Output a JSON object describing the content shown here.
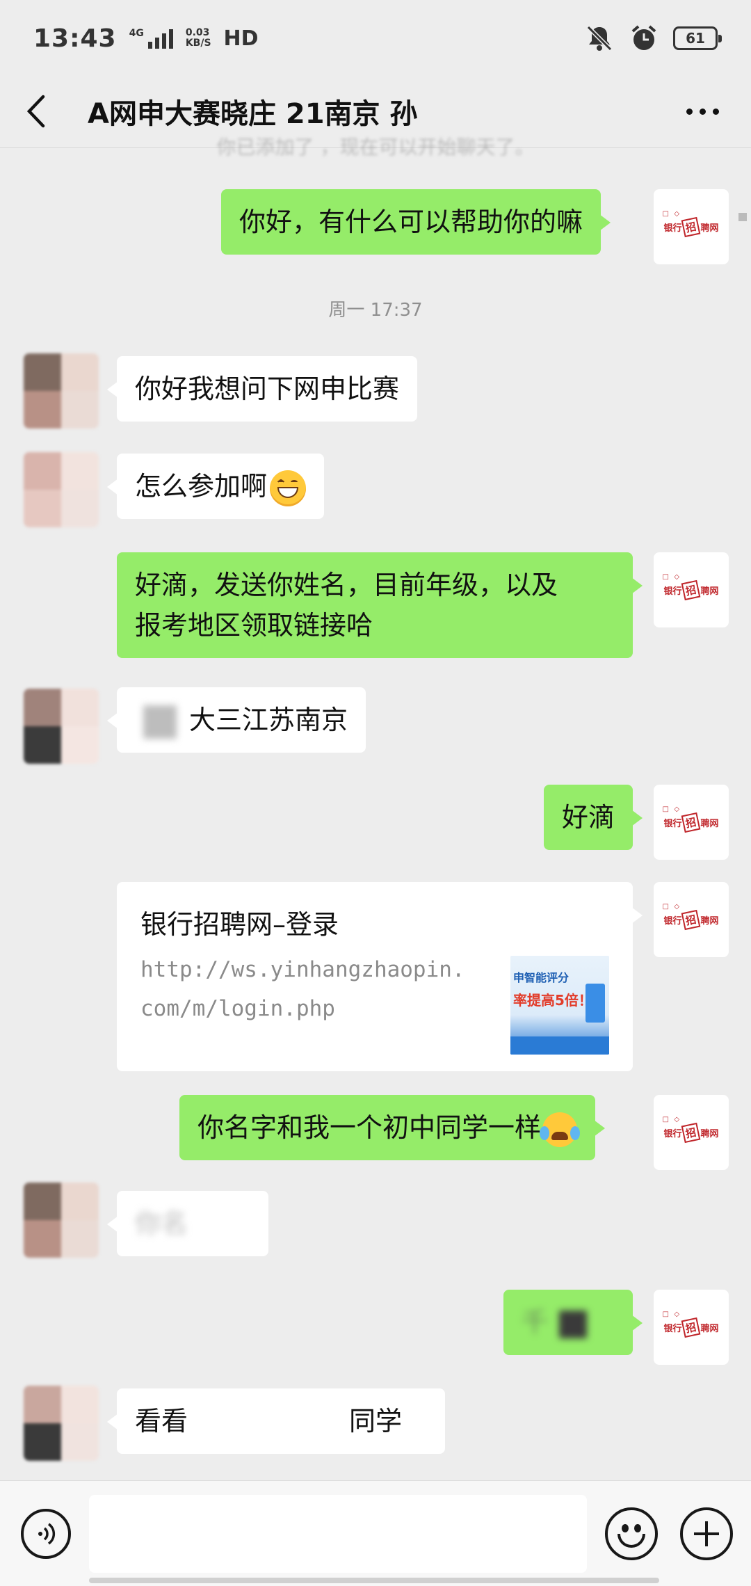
{
  "status_bar": {
    "time": "13:43",
    "network_tag": "4G",
    "speed_value": "0.03",
    "speed_unit": "KB/S",
    "hd": "HD",
    "battery": "61",
    "icons": [
      "signal-icon",
      "mute-bell-icon",
      "alarm-icon",
      "battery-icon"
    ]
  },
  "header": {
    "title": "A网申大赛晓庄 21南京 孙",
    "back_icon": "chevron-left-icon",
    "more_icon": "more-dots-icon"
  },
  "system_note": "你已添加了 ，现在可以开始聊天了。",
  "time_divider": "周一 17:37",
  "messages": [
    {
      "dir": "out",
      "text": "你好，有什么可以帮助你的嘛"
    },
    {
      "dir": "in",
      "text": "你好我想问下网申比赛"
    },
    {
      "dir": "in",
      "text": "怎么参加啊",
      "emoji": "grinning-face"
    },
    {
      "dir": "out",
      "line1": "好滴，发送你姓名，目前年级，以及",
      "line2": "报考地区领取链接哈"
    },
    {
      "dir": "in",
      "text": "大三江苏南京"
    },
    {
      "dir": "out",
      "text": "好滴"
    },
    {
      "dir": "out",
      "type": "link"
    },
    {
      "dir": "out",
      "text": "你名字和我一个初中同学一样",
      "emoji": "crying-face"
    },
    {
      "dir": "in",
      "text": "你名"
    },
    {
      "dir": "out",
      "text": "千"
    },
    {
      "dir": "in",
      "pre": "看看",
      "post": "同学"
    }
  ],
  "link_card": {
    "title": "银行招聘网–登录",
    "url": "http://ws.yinhangzhaopin.com/m/login.php",
    "thumb_line1": "申智能评分",
    "thumb_line2": "率提高5倍！"
  },
  "bank_avatar": {
    "label_left": "银行",
    "label_box": "招",
    "label_right": "聘网"
  },
  "input_bar": {
    "voice_icon": "voice-icon",
    "emoji_icon": "emoji-icon",
    "plus_icon": "plus-icon"
  }
}
